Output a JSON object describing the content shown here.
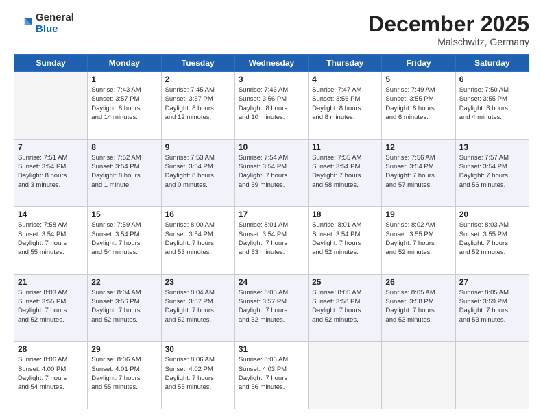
{
  "logo": {
    "general": "General",
    "blue": "Blue"
  },
  "header": {
    "month": "December 2025",
    "location": "Malschwitz, Germany"
  },
  "weekdays": [
    "Sunday",
    "Monday",
    "Tuesday",
    "Wednesday",
    "Thursday",
    "Friday",
    "Saturday"
  ],
  "weeks": [
    [
      {
        "day": "",
        "info": ""
      },
      {
        "day": "1",
        "info": "Sunrise: 7:43 AM\nSunset: 3:57 PM\nDaylight: 8 hours\nand 14 minutes."
      },
      {
        "day": "2",
        "info": "Sunrise: 7:45 AM\nSunset: 3:57 PM\nDaylight: 8 hours\nand 12 minutes."
      },
      {
        "day": "3",
        "info": "Sunrise: 7:46 AM\nSunset: 3:56 PM\nDaylight: 8 hours\nand 10 minutes."
      },
      {
        "day": "4",
        "info": "Sunrise: 7:47 AM\nSunset: 3:56 PM\nDaylight: 8 hours\nand 8 minutes."
      },
      {
        "day": "5",
        "info": "Sunrise: 7:49 AM\nSunset: 3:55 PM\nDaylight: 8 hours\nand 6 minutes."
      },
      {
        "day": "6",
        "info": "Sunrise: 7:50 AM\nSunset: 3:55 PM\nDaylight: 8 hours\nand 4 minutes."
      }
    ],
    [
      {
        "day": "7",
        "info": "Sunrise: 7:51 AM\nSunset: 3:54 PM\nDaylight: 8 hours\nand 3 minutes."
      },
      {
        "day": "8",
        "info": "Sunrise: 7:52 AM\nSunset: 3:54 PM\nDaylight: 8 hours\nand 1 minute."
      },
      {
        "day": "9",
        "info": "Sunrise: 7:53 AM\nSunset: 3:54 PM\nDaylight: 8 hours\nand 0 minutes."
      },
      {
        "day": "10",
        "info": "Sunrise: 7:54 AM\nSunset: 3:54 PM\nDaylight: 7 hours\nand 59 minutes."
      },
      {
        "day": "11",
        "info": "Sunrise: 7:55 AM\nSunset: 3:54 PM\nDaylight: 7 hours\nand 58 minutes."
      },
      {
        "day": "12",
        "info": "Sunrise: 7:56 AM\nSunset: 3:54 PM\nDaylight: 7 hours\nand 57 minutes."
      },
      {
        "day": "13",
        "info": "Sunrise: 7:57 AM\nSunset: 3:54 PM\nDaylight: 7 hours\nand 56 minutes."
      }
    ],
    [
      {
        "day": "14",
        "info": "Sunrise: 7:58 AM\nSunset: 3:54 PM\nDaylight: 7 hours\nand 55 minutes."
      },
      {
        "day": "15",
        "info": "Sunrise: 7:59 AM\nSunset: 3:54 PM\nDaylight: 7 hours\nand 54 minutes."
      },
      {
        "day": "16",
        "info": "Sunrise: 8:00 AM\nSunset: 3:54 PM\nDaylight: 7 hours\nand 53 minutes."
      },
      {
        "day": "17",
        "info": "Sunrise: 8:01 AM\nSunset: 3:54 PM\nDaylight: 7 hours\nand 53 minutes."
      },
      {
        "day": "18",
        "info": "Sunrise: 8:01 AM\nSunset: 3:54 PM\nDaylight: 7 hours\nand 52 minutes."
      },
      {
        "day": "19",
        "info": "Sunrise: 8:02 AM\nSunset: 3:55 PM\nDaylight: 7 hours\nand 52 minutes."
      },
      {
        "day": "20",
        "info": "Sunrise: 8:03 AM\nSunset: 3:55 PM\nDaylight: 7 hours\nand 52 minutes."
      }
    ],
    [
      {
        "day": "21",
        "info": "Sunrise: 8:03 AM\nSunset: 3:55 PM\nDaylight: 7 hours\nand 52 minutes."
      },
      {
        "day": "22",
        "info": "Sunrise: 8:04 AM\nSunset: 3:56 PM\nDaylight: 7 hours\nand 52 minutes."
      },
      {
        "day": "23",
        "info": "Sunrise: 8:04 AM\nSunset: 3:57 PM\nDaylight: 7 hours\nand 52 minutes."
      },
      {
        "day": "24",
        "info": "Sunrise: 8:05 AM\nSunset: 3:57 PM\nDaylight: 7 hours\nand 52 minutes."
      },
      {
        "day": "25",
        "info": "Sunrise: 8:05 AM\nSunset: 3:58 PM\nDaylight: 7 hours\nand 52 minutes."
      },
      {
        "day": "26",
        "info": "Sunrise: 8:05 AM\nSunset: 3:58 PM\nDaylight: 7 hours\nand 53 minutes."
      },
      {
        "day": "27",
        "info": "Sunrise: 8:05 AM\nSunset: 3:59 PM\nDaylight: 7 hours\nand 53 minutes."
      }
    ],
    [
      {
        "day": "28",
        "info": "Sunrise: 8:06 AM\nSunset: 4:00 PM\nDaylight: 7 hours\nand 54 minutes."
      },
      {
        "day": "29",
        "info": "Sunrise: 8:06 AM\nSunset: 4:01 PM\nDaylight: 7 hours\nand 55 minutes."
      },
      {
        "day": "30",
        "info": "Sunrise: 8:06 AM\nSunset: 4:02 PM\nDaylight: 7 hours\nand 55 minutes."
      },
      {
        "day": "31",
        "info": "Sunrise: 8:06 AM\nSunset: 4:03 PM\nDaylight: 7 hours\nand 56 minutes."
      },
      {
        "day": "",
        "info": ""
      },
      {
        "day": "",
        "info": ""
      },
      {
        "day": "",
        "info": ""
      }
    ]
  ]
}
